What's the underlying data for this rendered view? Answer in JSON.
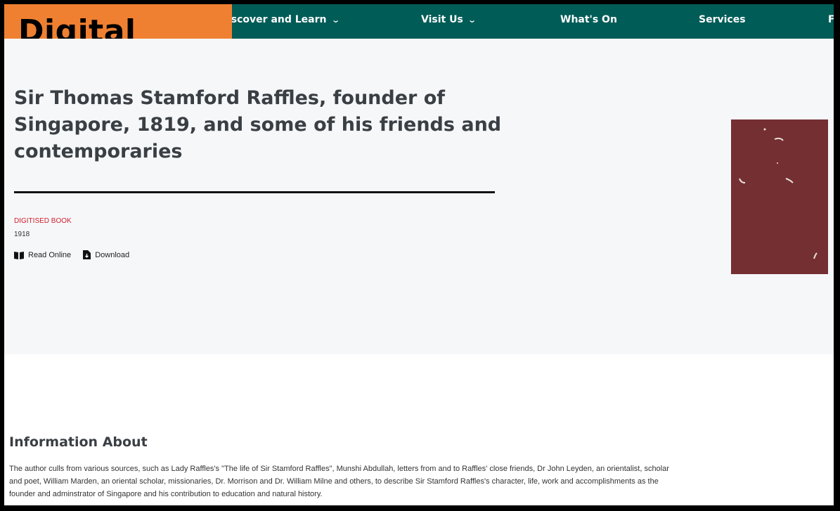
{
  "nav": {
    "items": [
      {
        "label": "iscover and Learn",
        "has_dropdown": true
      },
      {
        "label": "Visit Us",
        "has_dropdown": true
      },
      {
        "label": "What's On",
        "has_dropdown": false
      },
      {
        "label": "Services",
        "has_dropdown": false
      },
      {
        "label": "F",
        "has_dropdown": false
      }
    ],
    "chevron": "⌄"
  },
  "badge": {
    "label": "Digital book",
    "color": "#ef8031"
  },
  "book": {
    "title": "Sir Thomas Stamford Raffles, founder of Singapore, 1819, and some of his friends and contemporaries",
    "type_label": "DIGITISED BOOK",
    "year": "1918",
    "actions": [
      {
        "label": "Read Online",
        "icon": "book-open-icon"
      },
      {
        "label": "Download",
        "icon": "file-download-icon"
      }
    ],
    "cover_color": "#7a3236"
  },
  "info": {
    "heading": "Information About",
    "text": "The author culls from various sources, such as Lady Raffles's \"The life of Sir Stamford Raffles\", Munshi Abdullah, letters from and to Raffles' close friends, Dr John Leyden, an orientalist, scholar and poet, William Marden, an oriental scholar, missionaries, Dr. Morrison and Dr. William Milne and others, to describe Sir Stamford Raffles's character, life, work and accomplishments as the founder and adminstrator of Singapore and his contribution to education and natural history."
  },
  "colors": {
    "nav_bg": "#005c57",
    "accent_red": "#d0202e",
    "hero_bg": "#f6f7f9"
  }
}
